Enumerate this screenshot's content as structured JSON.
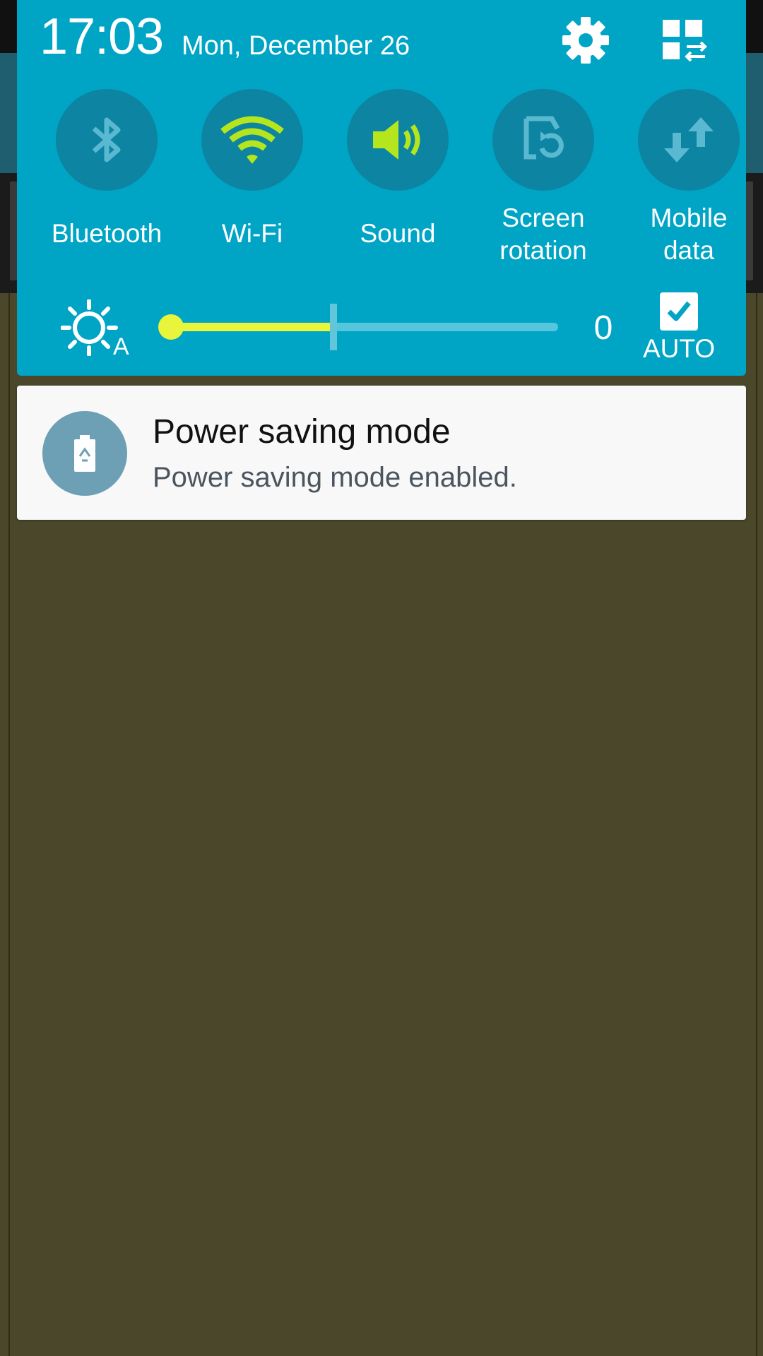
{
  "status_panel": {
    "time": "17:03",
    "date": "Mon, December 26"
  },
  "quick_toggles": [
    {
      "label": "Bluetooth",
      "icon": "bluetooth-icon",
      "state": "off"
    },
    {
      "label": "Wi-Fi",
      "icon": "wifi-icon",
      "state": "on"
    },
    {
      "label": "Sound",
      "icon": "sound-icon",
      "state": "on"
    },
    {
      "label": "Screen rotation",
      "icon": "screen-rotation-icon",
      "state": "off"
    },
    {
      "label": "Mobile data",
      "icon": "mobile-data-icon",
      "state": "off"
    }
  ],
  "brightness": {
    "value": "0",
    "level_fraction": 0.42,
    "auto_label": "AUTO",
    "auto_checked": true
  },
  "notification": {
    "title": "Power saving mode",
    "text": "Power saving mode enabled.",
    "icon": "power-saving-battery-icon"
  },
  "colors": {
    "panel": "#00a5c6",
    "toggle_circle": "#0c84a2",
    "active_icon": "#b5e61d",
    "inactive_icon": "#5ab9d1",
    "slider_fill": "#e8f53a",
    "notification_icon_bg": "#6d9fb5",
    "background": "#4b472b"
  }
}
